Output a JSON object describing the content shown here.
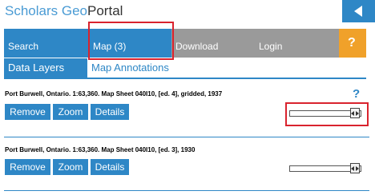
{
  "header": {
    "logo_part1": "Scholars ",
    "logo_part2": "Geo",
    "logo_part3": "Portal",
    "back_icon": "back-arrow-icon"
  },
  "nav": {
    "search": "Search",
    "map": "Map (3)",
    "download": "Download",
    "login": "Login",
    "help": "?"
  },
  "subnav": {
    "data_layers": "Data Layers",
    "map_annotations": "Map Annotations"
  },
  "layers": [
    {
      "title": "Port Burwell, Ontario. 1:63,360. Map Sheet 040I10, [ed. 4], gridded, 1937",
      "help": "?",
      "buttons": {
        "remove": "Remove",
        "zoom": "Zoom",
        "details": "Details"
      },
      "opacity": 1.0
    },
    {
      "title": "Port Burwell, Ontario. 1:63,360. Map Sheet 040I10, [ed. 3], 1930",
      "buttons": {
        "remove": "Remove",
        "zoom": "Zoom",
        "details": "Details"
      },
      "opacity": 1.0
    }
  ],
  "colors": {
    "accent": "#2e87c6",
    "inactive_tab": "#9a9a9a",
    "help_tab": "#f0a12a",
    "highlight": "#d9232e"
  }
}
